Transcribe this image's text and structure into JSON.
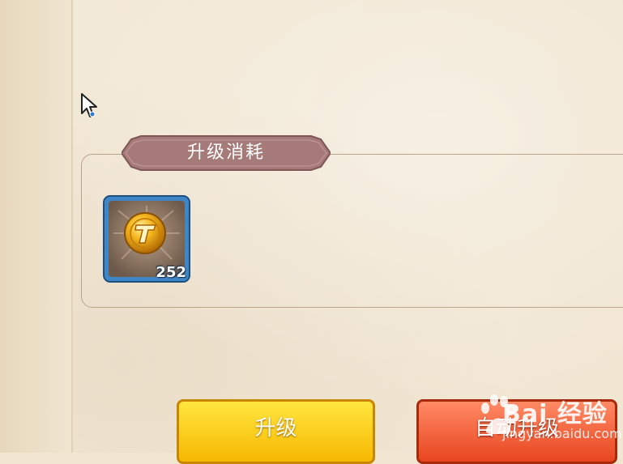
{
  "cost_panel": {
    "title": "升级消耗",
    "item": {
      "icon": "gold-coin-icon",
      "count": "252"
    }
  },
  "buttons": {
    "upgrade_label": "升级",
    "auto_upgrade_label": "自动升级"
  },
  "watermark": {
    "brand": "Bai 经验",
    "url": "jingyan.baidu.com"
  },
  "colors": {
    "panel_border": "#b8a58b",
    "title_tab": "#a57a78",
    "upgrade_button": "#f8c300",
    "auto_upgrade_button": "#ee5530"
  }
}
